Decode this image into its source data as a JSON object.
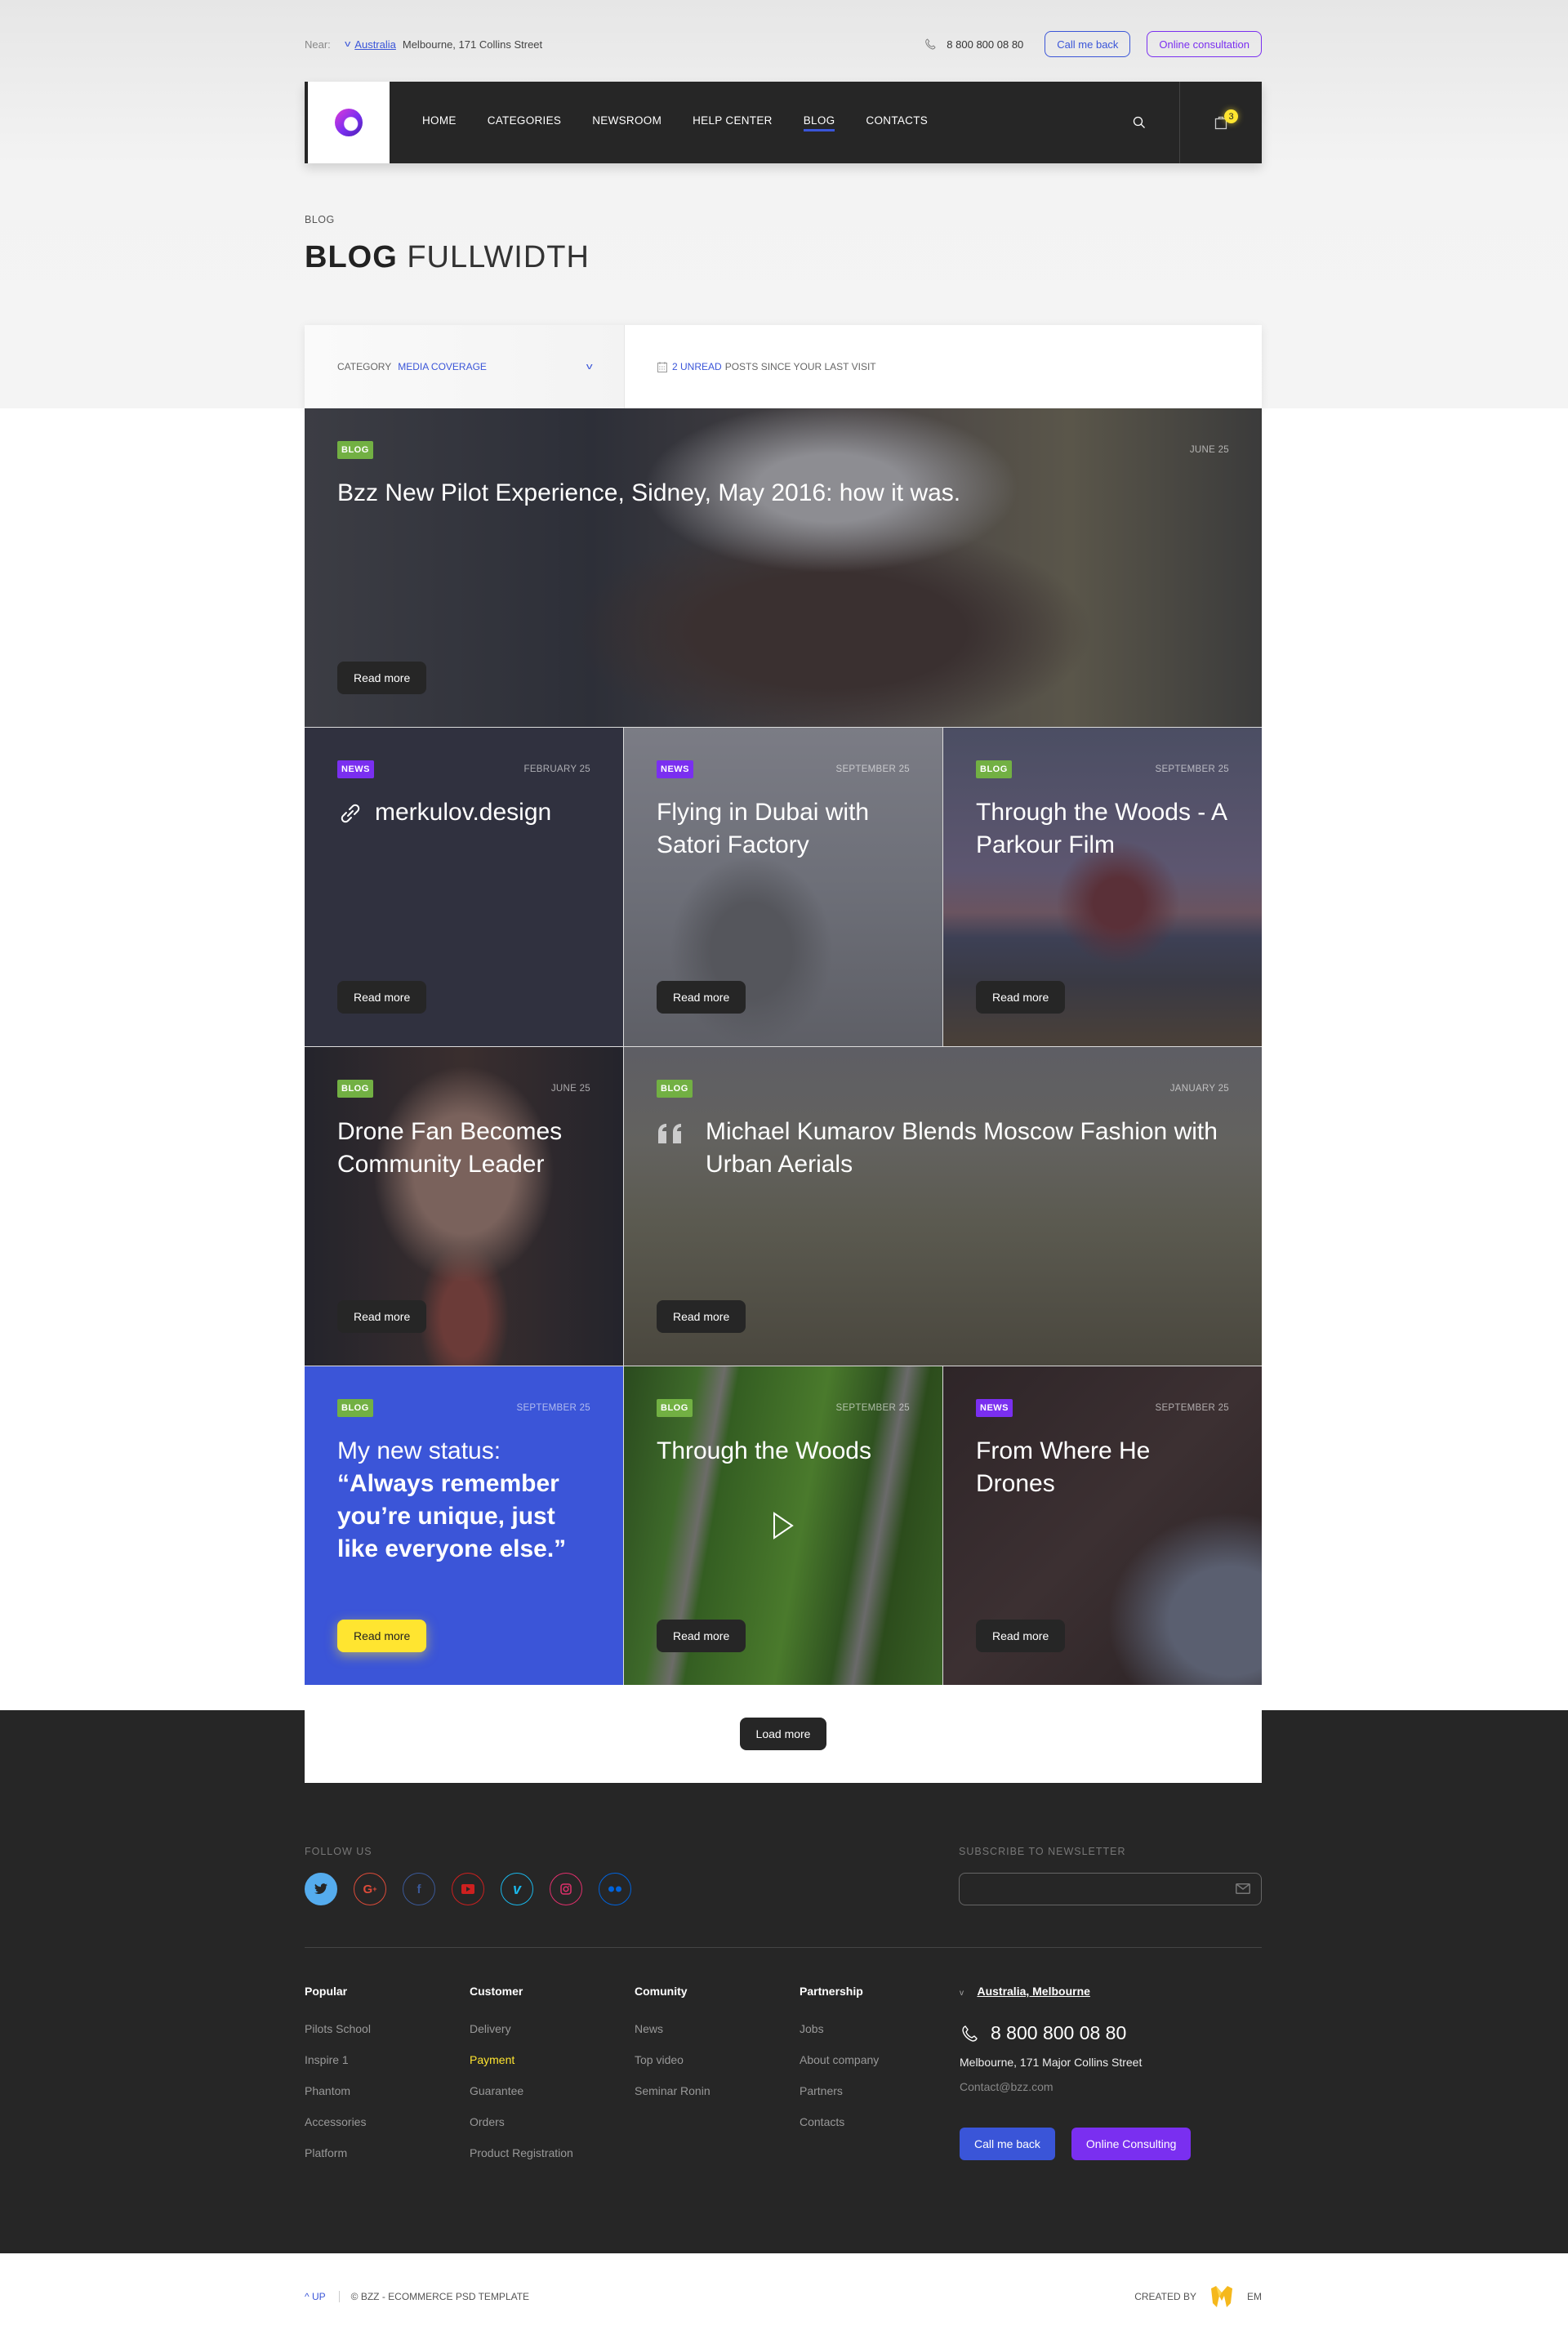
{
  "topbar": {
    "near_label": "Near:",
    "country": "Australia",
    "address": "Melbourne, 171 Collins Street",
    "phone": "8 800 800 08 80",
    "call_back": "Call me back",
    "online": "Online consultation"
  },
  "nav": {
    "items": [
      {
        "label": "HOME"
      },
      {
        "label": "CATEGORIES"
      },
      {
        "label": "NEWSROOM"
      },
      {
        "label": "HELP CENTER"
      },
      {
        "label": "BLOG",
        "active": true
      },
      {
        "label": "CONTACTS"
      }
    ],
    "cart_count": "3"
  },
  "page": {
    "breadcrumb": "BLOG",
    "title_bold": "BLOG",
    "title_light": "FULLWIDTH"
  },
  "filter": {
    "category_label": "CATEGORY",
    "category_value": "MEDIA COVERAGE",
    "unread_count": "2 UNREAD",
    "unread_text": "POSTS SINCE YOUR LAST VISIT"
  },
  "posts": [
    {
      "tag": "BLOG",
      "date": "JUNE 25",
      "title": "Bzz New Pilot Experience, Sidney, May 2016: how it was.",
      "read_more": "Read more"
    },
    {
      "tag": "NEWS",
      "date": "FEBRUARY 25",
      "title": "merkulov.design",
      "read_more": "Read more"
    },
    {
      "tag": "NEWS",
      "date": "SEPTEMBER 25",
      "title": "Flying in Dubai with Satori Factory",
      "read_more": "Read more"
    },
    {
      "tag": "BLOG",
      "date": "SEPTEMBER 25",
      "title": "Through the Woods - A Parkour Film",
      "read_more": "Read more"
    },
    {
      "tag": "BLOG",
      "date": "JUNE 25",
      "title": "Drone Fan Becomes Community Leader",
      "read_more": "Read more"
    },
    {
      "tag": "BLOG",
      "date": "JANUARY 25",
      "title": "Michael Kumarov Blends Moscow Fashion with Urban Aerials",
      "read_more": "Read more"
    },
    {
      "tag": "BLOG",
      "date": "SEPTEMBER 25",
      "title_light": "My new status:",
      "title_bold": "“Always remember you’re unique, just like everyone else.”",
      "read_more": "Read more"
    },
    {
      "tag": "BLOG",
      "date": "SEPTEMBER 25",
      "title": "Through the Woods",
      "read_more": "Read more"
    },
    {
      "tag": "NEWS",
      "date": "SEPTEMBER 25",
      "title": "From Where He Drones",
      "read_more": "Read more"
    }
  ],
  "load_more": "Load more",
  "footer": {
    "follow_us": "FOLLOW US",
    "socials": [
      "twitter",
      "google-plus",
      "facebook",
      "youtube",
      "vimeo",
      "instagram",
      "flickr"
    ],
    "subscribe_label": "SUBSCRIBE TO NEWSLETTER",
    "subscribe_placeholder": "",
    "columns": [
      {
        "title": "Popular",
        "links": [
          "Pilots School",
          "Inspire 1",
          "Phantom",
          "Accessories",
          "Platform"
        ]
      },
      {
        "title": "Customer",
        "links": [
          "Delivery",
          "Payment",
          "Guarantee",
          "Orders",
          "Product Registration"
        ]
      },
      {
        "title": "Comunity",
        "links": [
          "News",
          "Top video",
          "Seminar Ronin"
        ]
      },
      {
        "title": "Partnership",
        "links": [
          "Jobs",
          "About company",
          "Partners",
          "Contacts"
        ]
      }
    ],
    "contact": {
      "city": "Australia, Melbourne",
      "phone": "8 800 800 08 80",
      "address": "Melbourne, 171 Major Collins Street",
      "email": "Contact@bzz.com",
      "call_back": "Call me back",
      "online": "Online Consulting"
    }
  },
  "bottom": {
    "up": "UP",
    "copyright": "© BZZ - ECOMMERCE PSD TEMPLATE",
    "created_by": "CREATED BY",
    "author": "EM"
  },
  "colors": {
    "accent_blue": "#3a55d8",
    "accent_purple": "#7a2ff0",
    "tag_blog": "#72b043",
    "highlight_yellow": "#ffe530",
    "dark": "#262626"
  }
}
